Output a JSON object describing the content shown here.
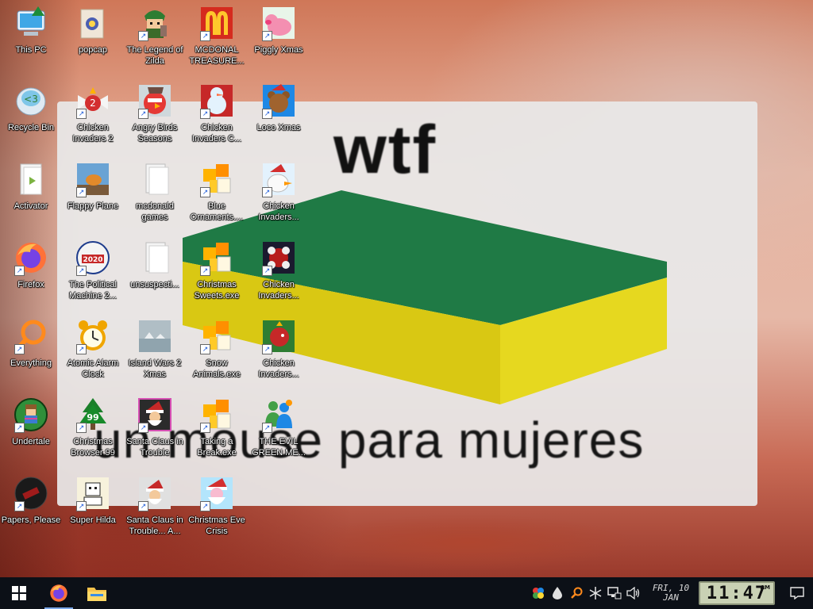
{
  "wallpaper": {
    "top_text": "wtf",
    "bottom_text": "un mouse para mujeres"
  },
  "desktop_icons": [
    {
      "label": "This PC",
      "icon": "this-pc-icon"
    },
    {
      "label": "Recycle Bin",
      "icon": "recycle-bin-icon"
    },
    {
      "label": "Activator",
      "icon": "activator-icon"
    },
    {
      "label": "Firefox",
      "icon": "firefox-icon"
    },
    {
      "label": "Everything",
      "icon": "everything-icon"
    },
    {
      "label": "Undertale",
      "icon": "undertale-icon"
    },
    {
      "label": "Papers, Please",
      "icon": "papers-please-icon"
    },
    {
      "label": "popcap",
      "icon": "popcap-icon"
    },
    {
      "label": "Chicken Invaders 2",
      "icon": "chicken-invaders-2-icon"
    },
    {
      "label": "Flappy Plane",
      "icon": "flappy-plane-icon"
    },
    {
      "label": "The Political Machine 2...",
      "icon": "political-machine-icon"
    },
    {
      "label": "Atomic Alarm Clock",
      "icon": "alarm-clock-icon"
    },
    {
      "label": "Christmas Browser 99",
      "icon": "christmas-tree-icon"
    },
    {
      "label": "Super Hilda",
      "icon": "super-hilda-icon"
    },
    {
      "label": "The Legend of Zilda",
      "icon": "legend-zilda-icon"
    },
    {
      "label": "Angry Birds Seasons",
      "icon": "angry-birds-icon"
    },
    {
      "label": "mcdonald games",
      "icon": "folder-icon"
    },
    {
      "label": "unsuspecti...",
      "icon": "folder-icon"
    },
    {
      "label": "Island Wars 2 Xmas",
      "icon": "island-wars-icon"
    },
    {
      "label": "Santa Claus in Trouble",
      "icon": "santa-trouble-icon"
    },
    {
      "label": "Santa Claus in Trouble... A...",
      "icon": "santa-trouble-2-icon"
    },
    {
      "label": "MCDONAL TREASURE...",
      "icon": "mcdonalds-icon"
    },
    {
      "label": "Chicken Invaders C...",
      "icon": "snowman-icon"
    },
    {
      "label": "Blue Ornaments....",
      "icon": "puzzle-icon"
    },
    {
      "label": "Christmas Sweets.exe",
      "icon": "puzzle-icon"
    },
    {
      "label": "Snow Animals.exe",
      "icon": "puzzle-icon"
    },
    {
      "label": "Taking a Break.exe",
      "icon": "puzzle-icon"
    },
    {
      "label": "Christmas Eve Crisis",
      "icon": "santa-icon"
    },
    {
      "label": "Piggly Xmas",
      "icon": "pig-icon"
    },
    {
      "label": "Loco Xmas",
      "icon": "teddy-bear-icon"
    },
    {
      "label": "Chicken Invaders...",
      "icon": "chicken-santa-icon"
    },
    {
      "label": "Chicken Invaders...",
      "icon": "chicken-invaders-4-icon"
    },
    {
      "label": "Chicken Invaders...",
      "icon": "chicken-invaders-5-icon"
    },
    {
      "label": "THE EVIL GREEN ME...",
      "icon": "messenger-icon"
    }
  ],
  "taskbar": {
    "pinned": [
      {
        "name": "start-button",
        "icon": "windows-icon"
      },
      {
        "name": "firefox-taskbar-button",
        "icon": "firefox-icon"
      },
      {
        "name": "file-explorer-taskbar-button",
        "icon": "folder-icon"
      }
    ],
    "tray_icons": [
      "security-icon",
      "droplet-icon",
      "search-icon",
      "snowflake-icon",
      "network-icon",
      "volume-icon"
    ],
    "date_line1": "FRI, 10",
    "date_line2": "JAN",
    "clock_time": "11:47",
    "clock_ampm": "AM"
  },
  "colors": {
    "taskbar_bg": "#0c1017",
    "icon_label_text": "#ffffff",
    "clock_lcd": "#c9d1b4",
    "accent": "#7aa7e8"
  }
}
